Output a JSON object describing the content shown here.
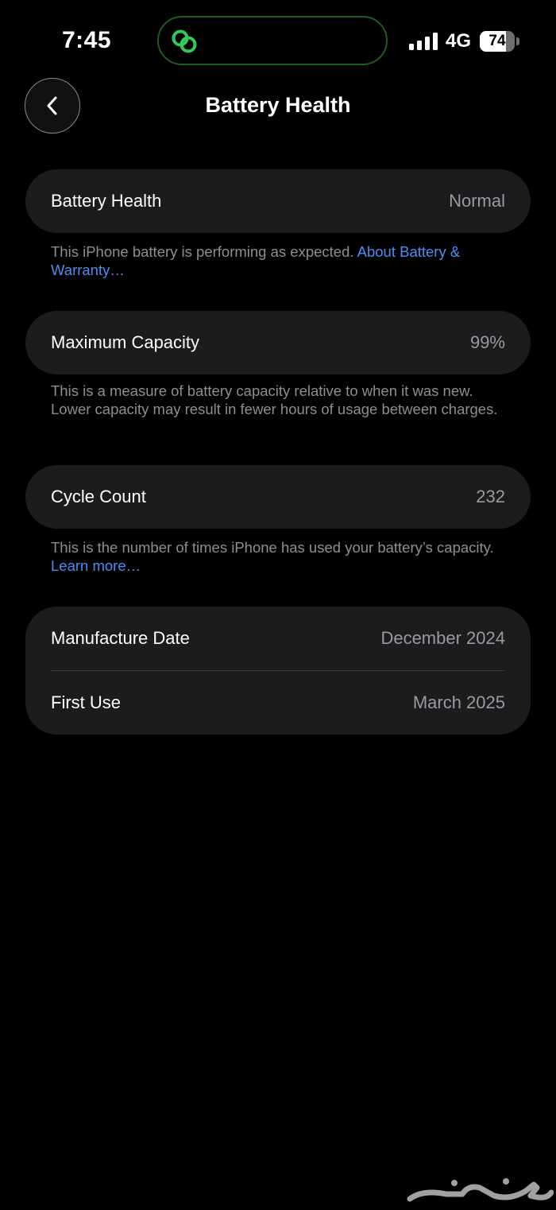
{
  "status_bar": {
    "time": "7:45",
    "network": "4G",
    "battery_percent": "74",
    "battery_level": 0.74,
    "signal_bars": 4,
    "island_icon": "link-rings-icon",
    "island_icon_color": "#34c759"
  },
  "nav": {
    "title": "Battery Health",
    "back_icon": "chevron-left-icon"
  },
  "health": {
    "label": "Battery Health",
    "value": "Normal",
    "note": "This iPhone battery is performing as expected.",
    "link": "About Battery & Warranty…"
  },
  "capacity": {
    "label": "Maximum Capacity",
    "value": "99%",
    "note": "This is a measure of battery capacity relative to when it was new. Lower capacity may result in fewer hours of usage between charges."
  },
  "cycles": {
    "label": "Cycle Count",
    "value": "232",
    "note": "This is the number of times iPhone has used your battery’s capacity.",
    "link": "Learn more…"
  },
  "dates": {
    "manufacture_label": "Manufacture Date",
    "manufacture_value": "December 2024",
    "first_use_label": "First Use",
    "first_use_value": "March 2025"
  },
  "colors": {
    "background": "#000000",
    "card": "#1c1c1e",
    "secondary_text": "#8e8e93",
    "link": "#4b8ef2"
  },
  "watermark_icon": "haraj-logo-watermark"
}
